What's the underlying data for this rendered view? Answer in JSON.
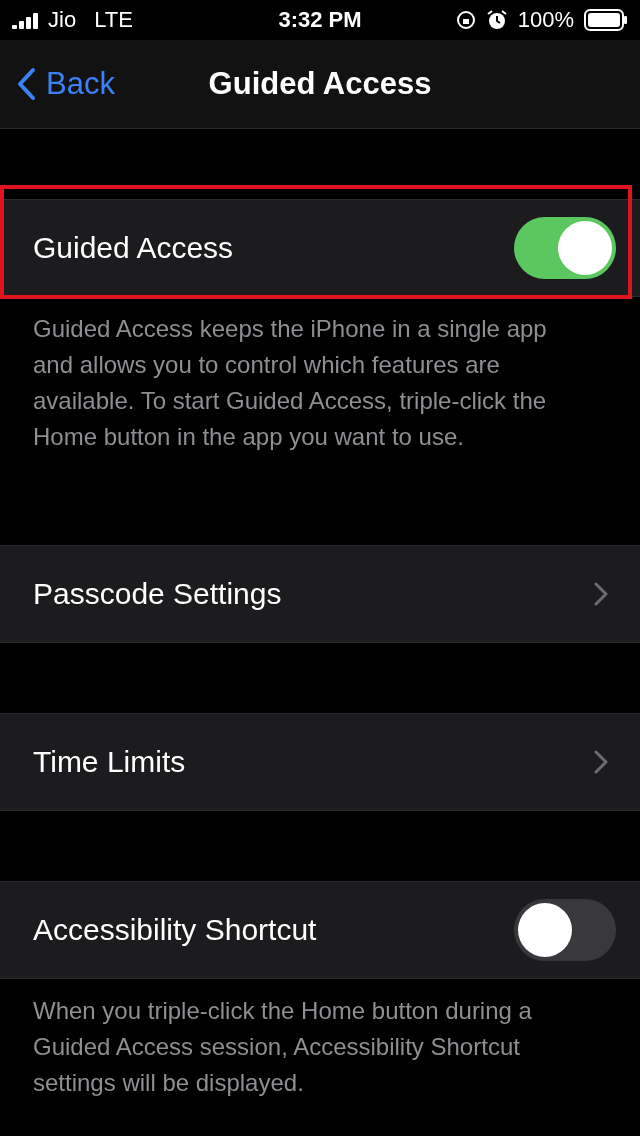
{
  "status_bar": {
    "carrier": "Jio",
    "network": "LTE",
    "time": "3:32 PM",
    "battery": "100%"
  },
  "nav": {
    "back": "Back",
    "title": "Guided Access"
  },
  "sections": [
    {
      "rows": [
        {
          "kind": "toggle",
          "label": "Guided Access",
          "on": true,
          "highlighted": true
        }
      ],
      "footer": "Guided Access keeps the iPhone in a single app and allows you to control which features are available. To start Guided Access, triple-click the Home button in the app you want to use."
    },
    {
      "rows": [
        {
          "kind": "link",
          "label": "Passcode Settings",
          "highlighted": false
        }
      ]
    },
    {
      "rows": [
        {
          "kind": "link",
          "label": "Time Limits",
          "highlighted": false
        }
      ]
    },
    {
      "rows": [
        {
          "kind": "toggle",
          "label": "Accessibility Shortcut",
          "on": false,
          "highlighted": false
        }
      ],
      "footer": "When you triple-click the Home button during a Guided Access session, Accessibility Shortcut settings will be displayed."
    }
  ]
}
